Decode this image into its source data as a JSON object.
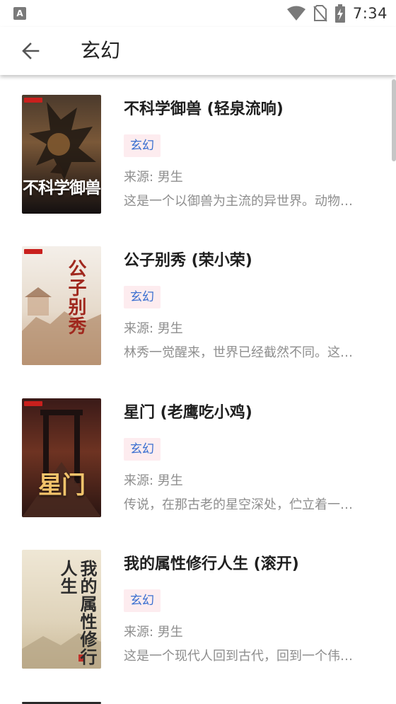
{
  "status_bar": {
    "time": "7:34",
    "left_icon": "A",
    "icons": [
      "wifi-icon",
      "no-sim-icon",
      "battery-charging-icon"
    ]
  },
  "app_bar": {
    "back_icon": "arrow-left-icon",
    "title": "玄幻"
  },
  "books": [
    {
      "title": "不科学御兽 (轻泉流响)",
      "tag": "玄幻",
      "source": "来源: 男生",
      "intro": "这是一个以御兽为主流的异世界。动物、植物、甚至是元素都能成为御兽师的伙伴……",
      "cover_text": "不科学御兽",
      "cover_colors": [
        "#3b2a22",
        "#8c5a2e",
        "#1b1511"
      ]
    },
    {
      "title": "公子别秀 (荣小荣)",
      "tag": "玄幻",
      "source": "来源: 男生",
      "intro": "林秀一觉醒来，世界已经截然不同。这里是一个觉醒者的世界……",
      "cover_text": "公子别秀",
      "cover_colors": [
        "#f1ece6",
        "#d7c6b3",
        "#a86d4a"
      ]
    },
    {
      "title": "星门 (老鹰吃小鸡)",
      "tag": "玄幻",
      "source": "来源: 男生",
      "intro": "传说，在那古老的星空深处，伫立着一道血与火侵染的红色之门……",
      "cover_text": "星门",
      "cover_colors": [
        "#4a1d1a",
        "#7d3a26",
        "#1d1110"
      ]
    },
    {
      "title": "我的属性修行人生 (滚开)",
      "tag": "玄幻",
      "source": "来源: 男生",
      "intro": "这是一个现代人回到古代，回到一个伟力归于自身的世界……",
      "cover_text": "我的属性修行人生",
      "cover_colors": [
        "#ece3cf",
        "#d9ccb1",
        "#b9a88a"
      ]
    }
  ]
}
